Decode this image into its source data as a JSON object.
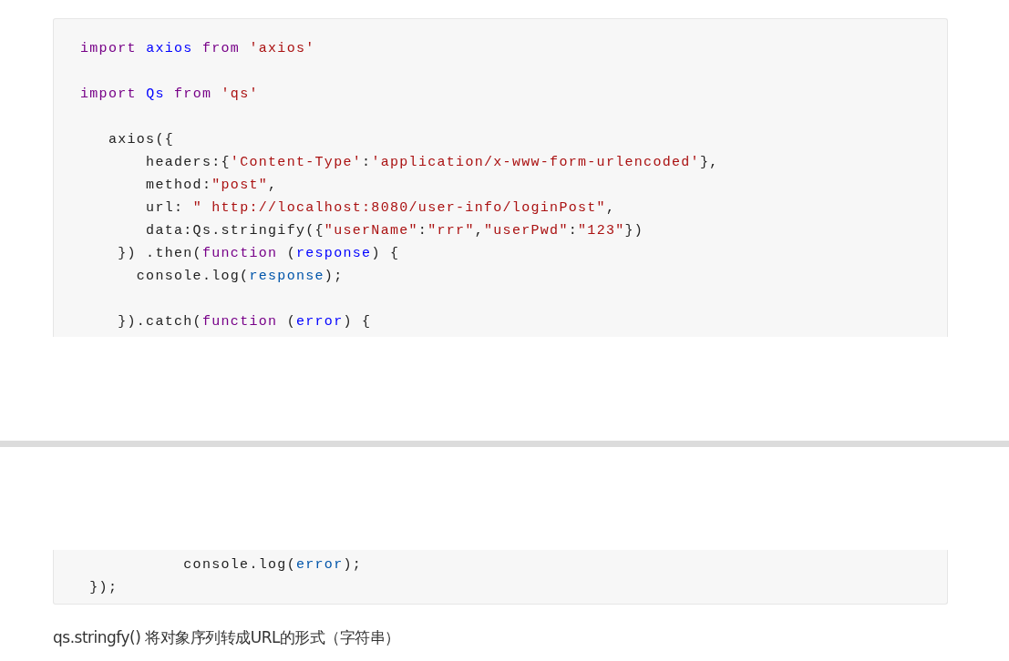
{
  "code_blocks": [
    {
      "lines": [
        {
          "kind": "code",
          "tokens": [
            {
              "kind": "keyword",
              "text": "import "
            },
            {
              "kind": "def",
              "text": "axios "
            },
            {
              "kind": "keyword",
              "text": "from "
            },
            {
              "kind": "string",
              "text": "'axios'"
            }
          ]
        },
        {
          "kind": "blank"
        },
        {
          "kind": "code",
          "tokens": [
            {
              "kind": "keyword",
              "text": "import "
            },
            {
              "kind": "def",
              "text": "Qs "
            },
            {
              "kind": "keyword",
              "text": "from "
            },
            {
              "kind": "string",
              "text": "'qs'"
            }
          ]
        },
        {
          "kind": "blank"
        },
        {
          "kind": "code",
          "tokens": [
            {
              "kind": "plain",
              "text": "   axios({"
            }
          ]
        },
        {
          "kind": "code",
          "tokens": [
            {
              "kind": "plain",
              "text": "       headers:{"
            },
            {
              "kind": "string",
              "text": "'Content-Type'"
            },
            {
              "kind": "plain",
              "text": ":"
            },
            {
              "kind": "string",
              "text": "'application/x-www-form-urlencoded'"
            },
            {
              "kind": "plain",
              "text": "},"
            }
          ]
        },
        {
          "kind": "code",
          "tokens": [
            {
              "kind": "plain",
              "text": "       method:"
            },
            {
              "kind": "string",
              "text": "\"post\""
            },
            {
              "kind": "plain",
              "text": ","
            }
          ]
        },
        {
          "kind": "code",
          "tokens": [
            {
              "kind": "plain",
              "text": "       url: "
            },
            {
              "kind": "string",
              "text": "\" http://localhost:8080/user-info/loginPost\""
            },
            {
              "kind": "plain",
              "text": ","
            }
          ]
        },
        {
          "kind": "code",
          "tokens": [
            {
              "kind": "plain",
              "text": "       data:Qs.stringify({"
            },
            {
              "kind": "string",
              "text": "\"userName\""
            },
            {
              "kind": "plain",
              "text": ":"
            },
            {
              "kind": "string",
              "text": "\"rrr\""
            },
            {
              "kind": "plain",
              "text": ","
            },
            {
              "kind": "string",
              "text": "\"userPwd\""
            },
            {
              "kind": "plain",
              "text": ":"
            },
            {
              "kind": "string",
              "text": "\"123\""
            },
            {
              "kind": "plain",
              "text": "})"
            }
          ]
        },
        {
          "kind": "code",
          "tokens": [
            {
              "kind": "plain",
              "text": "    }) .then("
            },
            {
              "kind": "keyword",
              "text": "function"
            },
            {
              "kind": "plain",
              "text": " ("
            },
            {
              "kind": "def",
              "text": "response"
            },
            {
              "kind": "plain",
              "text": ") {"
            }
          ]
        },
        {
          "kind": "code",
          "tokens": [
            {
              "kind": "plain",
              "text": "      console.log("
            },
            {
              "kind": "variable",
              "text": "response"
            },
            {
              "kind": "plain",
              "text": ");"
            }
          ]
        },
        {
          "kind": "blank"
        },
        {
          "kind": "code",
          "tokens": [
            {
              "kind": "plain",
              "text": "    }).catch("
            },
            {
              "kind": "keyword",
              "text": "function"
            },
            {
              "kind": "plain",
              "text": " ("
            },
            {
              "kind": "def",
              "text": "error"
            },
            {
              "kind": "plain",
              "text": ") {"
            }
          ]
        }
      ]
    },
    {
      "lines": [
        {
          "kind": "code",
          "tokens": [
            {
              "kind": "plain",
              "text": "           console.log("
            },
            {
              "kind": "variable",
              "text": "error"
            },
            {
              "kind": "plain",
              "text": ");"
            }
          ]
        },
        {
          "kind": "code",
          "tokens": [
            {
              "kind": "plain",
              "text": " });"
            }
          ]
        }
      ]
    }
  ],
  "paragraph": "qs.stringfy() 将对象序列转成URL的形式（字符串）"
}
